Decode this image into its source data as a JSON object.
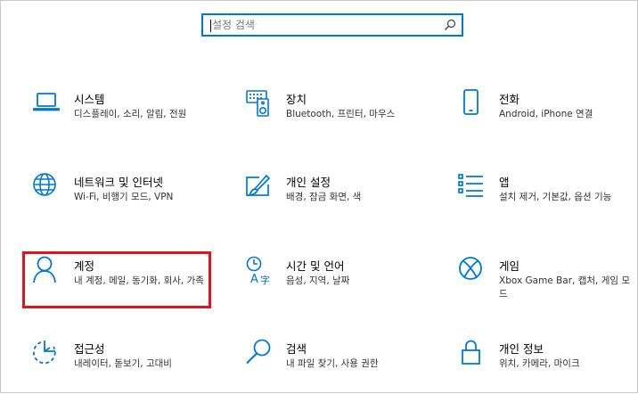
{
  "search": {
    "placeholder": "설정 검색",
    "icon": "search-icon"
  },
  "accent_color": "#0078d7",
  "highlight_color": "#e0141e",
  "tiles": [
    {
      "title": "시스템",
      "desc": "디스플레이, 소리, 알림, 전원",
      "icon": "laptop-icon"
    },
    {
      "title": "장치",
      "desc": "Bluetooth, 프린터, 마우스",
      "icon": "keyboard-speaker-icon"
    },
    {
      "title": "전화",
      "desc": "Android, iPhone 연결",
      "icon": "phone-icon"
    },
    {
      "title": "네트워크 및 인터넷",
      "desc": "Wi-Fi, 비행기 모드, VPN",
      "icon": "globe-icon"
    },
    {
      "title": "개인 설정",
      "desc": "배경, 잠금 화면, 색",
      "icon": "paint-brush-icon"
    },
    {
      "title": "앱",
      "desc": "설치 제거, 기본값, 옵션 기능",
      "icon": "apps-list-icon"
    },
    {
      "title": "계정",
      "desc": "내 계정, 메일, 동기화, 회사, 가족",
      "icon": "person-icon"
    },
    {
      "title": "시간 및 언어",
      "desc": "음성, 지역, 날짜",
      "icon": "language-icon"
    },
    {
      "title": "게임",
      "desc": "Xbox Game Bar, 캡처, 게임 모드",
      "icon": "xbox-icon"
    },
    {
      "title": "접근성",
      "desc": "내레이터, 돋보기, 고대비",
      "icon": "ease-of-access-icon"
    },
    {
      "title": "검색",
      "desc": "내 파일 찾기, 사용 권한",
      "icon": "search-icon"
    },
    {
      "title": "개인 정보",
      "desc": "위치, 카메라, 마이크",
      "icon": "lock-icon"
    }
  ]
}
